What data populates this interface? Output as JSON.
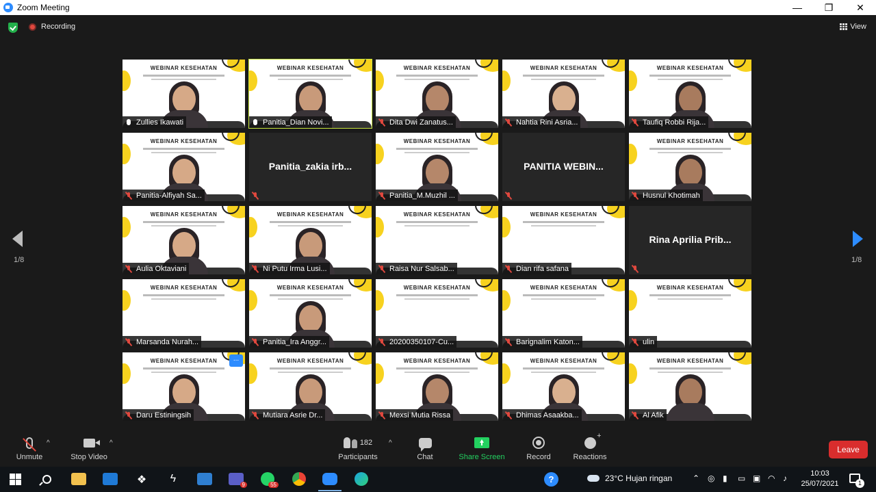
{
  "window": {
    "title": "Zoom Meeting",
    "controls": {
      "minimize": "—",
      "restore": "❐",
      "close": "✕"
    }
  },
  "topbar": {
    "recording_label": "Recording",
    "view_label": "View"
  },
  "gallery": {
    "page_left": "1/8",
    "page_right": "1/8",
    "participants": [
      {
        "name": "Zullies Ikawati",
        "mic": "on",
        "video": true
      },
      {
        "name": "Panitia_Dian Novi...",
        "mic": "on",
        "video": true,
        "active": true
      },
      {
        "name": "Dita Dwi Zanatus...",
        "mic": "muted",
        "video": true
      },
      {
        "name": "Nahtia Rini Asria...",
        "mic": "muted",
        "video": true
      },
      {
        "name": "Taufiq Robbi Rija...",
        "mic": "muted",
        "video": true
      },
      {
        "name": "Panitia-Alfiyah Sa...",
        "mic": "muted",
        "video": true
      },
      {
        "name": "Panitia_zakia  irb...",
        "mic": "muted",
        "video": false
      },
      {
        "name": "Panitia_M.Muzhil ...",
        "mic": "muted",
        "video": true
      },
      {
        "name": "PANITIA WEBIN...",
        "mic": "muted",
        "video": false
      },
      {
        "name": "Husnul Khotimah",
        "mic": "muted",
        "video": true
      },
      {
        "name": "Aulia Oktaviani",
        "mic": "muted",
        "video": true
      },
      {
        "name": "Ni Putu Irma Lusi...",
        "mic": "muted",
        "video": true
      },
      {
        "name": "Raisa Nur Salsab...",
        "mic": "muted",
        "video": true
      },
      {
        "name": "Dian rifa safana",
        "mic": "muted",
        "video": true
      },
      {
        "name": "Rina  Aprilia Prib...",
        "mic": "muted",
        "video": false
      },
      {
        "name": "Marsanda Nurah...",
        "mic": "muted",
        "video": true
      },
      {
        "name": "Panitia_Ira Anggr...",
        "mic": "muted",
        "video": true
      },
      {
        "name": "20200350107-Cu...",
        "mic": "muted",
        "video": true
      },
      {
        "name": "Barignalim Katon...",
        "mic": "muted",
        "video": true
      },
      {
        "name": "ulin",
        "mic": "muted",
        "video": true
      },
      {
        "name": "Daru Estiningsih",
        "mic": "muted",
        "video": true,
        "more": "..."
      },
      {
        "name": "Mutiara Asrie Dr...",
        "mic": "muted",
        "video": true
      },
      {
        "name": "Mexsi Mutia Rissa",
        "mic": "muted",
        "video": true
      },
      {
        "name": "Dhimas Asaakba...",
        "mic": "muted",
        "video": true
      },
      {
        "name": "Al Afik",
        "mic": "muted",
        "video": true
      }
    ],
    "webinar_banner": "WEBINAR KESEHATAN"
  },
  "toolbar": {
    "unmute": "Unmute",
    "stop_video": "Stop Video",
    "participants": "Participants",
    "participant_count": "182",
    "chat": "Chat",
    "share_screen": "Share Screen",
    "record": "Record",
    "reactions": "Reactions",
    "leave": "Leave",
    "caret": "^"
  },
  "taskbar": {
    "teams_badge": "9",
    "whatsapp_badge": "55",
    "help": "?",
    "weather": "23°C  Hujan ringan",
    "time": "10:03",
    "date": "25/07/2021",
    "notif_count": "1"
  },
  "colors": {
    "accent": "#2d8cff",
    "active_speaker": "#c8e63c",
    "muted": "#e0483e",
    "leave": "#d92d2d",
    "share": "#23d160"
  }
}
